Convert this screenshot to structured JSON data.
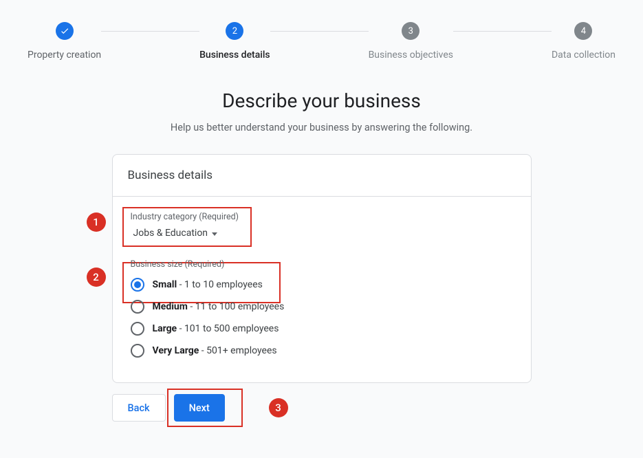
{
  "stepper": [
    {
      "label": "Property creation",
      "state": "done"
    },
    {
      "label": "Business details",
      "state": "active",
      "num": "2"
    },
    {
      "label": "Business objectives",
      "state": "pending",
      "num": "3"
    },
    {
      "label": "Data collection",
      "state": "pending",
      "num": "4"
    }
  ],
  "page": {
    "title": "Describe your business",
    "subtitle": "Help us better understand your business by answering the following."
  },
  "card": {
    "header": "Business details",
    "industry": {
      "label": "Industry category (Required)",
      "value": "Jobs & Education"
    },
    "size": {
      "label": "Business size (Required)",
      "options": [
        {
          "name": "Small",
          "desc": "1 to 10 employees",
          "selected": true
        },
        {
          "name": "Medium",
          "desc": "11 to 100 employees",
          "selected": false
        },
        {
          "name": "Large",
          "desc": "101 to 500 employees",
          "selected": false
        },
        {
          "name": "Very Large",
          "desc": "501+ employees",
          "selected": false
        }
      ]
    }
  },
  "buttons": {
    "back": "Back",
    "next": "Next"
  },
  "annotations": {
    "a1": "1",
    "a2": "2",
    "a3": "3"
  }
}
